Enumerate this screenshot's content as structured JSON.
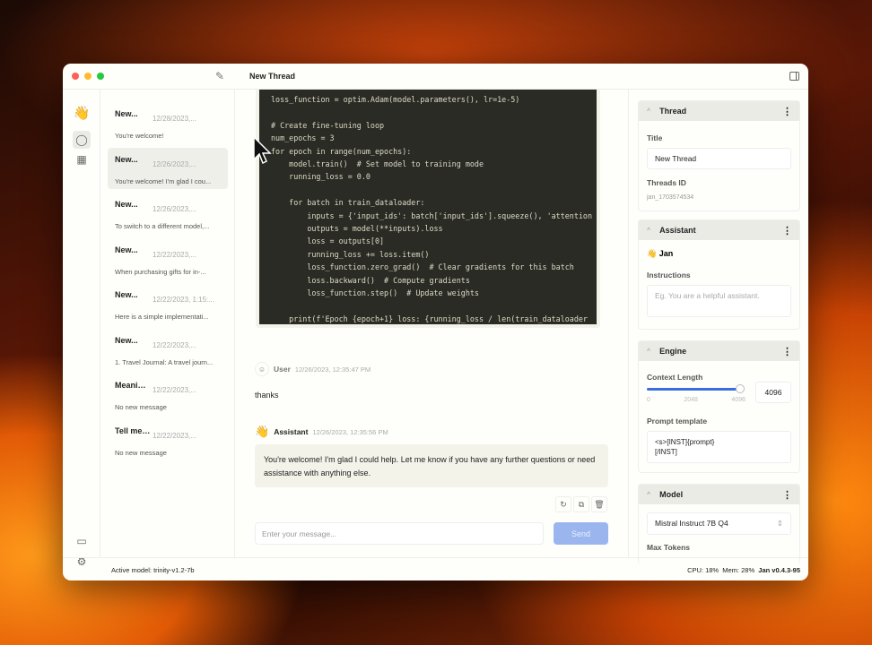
{
  "window": {
    "title": "New Thread"
  },
  "threads": [
    {
      "name": "New...",
      "date": "12/28/2023,...",
      "msg": "You're welcome!"
    },
    {
      "name": "New...",
      "date": "12/26/2023,...",
      "msg": "You're welcome! I'm glad I cou..."
    },
    {
      "name": "New...",
      "date": "12/26/2023,...",
      "msg": "To switch to a different model,..."
    },
    {
      "name": "New...",
      "date": "12/22/2023,...",
      "msg": "When purchasing gifts for in-..."
    },
    {
      "name": "New...",
      "date": "12/22/2023, 1:15:...",
      "msg": "Here is a simple implementati..."
    },
    {
      "name": "New...",
      "date": "12/22/2023,...",
      "msg": "1. Travel Journal: A travel journ..."
    },
    {
      "name": "Meaning ...",
      "date": "12/22/2023,...",
      "msg": "No new message"
    },
    {
      "name": "Tell me ...",
      "date": "12/22/2023,...",
      "msg": "No new message"
    }
  ],
  "code_lines": [
    "loss_function = optim.Adam(model.parameters(), lr=1e-5)",
    "",
    "# Create fine-tuning loop",
    "num_epochs = 3",
    "for epoch in range(num_epochs):",
    "    model.train()  # Set model to training mode",
    "    running_loss = 0.0",
    "",
    "    for batch in train_dataloader:",
    "        inputs = {'input_ids': batch['input_ids'].squeeze(), 'attention",
    "        outputs = model(**inputs).loss",
    "        loss = outputs[0]",
    "        running_loss += loss.item()",
    "        loss_function.zero_grad()  # Clear gradients for this batch",
    "        loss.backward()  # Compute gradients",
    "        loss_function.step()  # Update weights",
    "",
    "    print(f'Epoch {epoch+1} loss: {running_loss / len(train_dataloader"
  ],
  "messages": {
    "user": {
      "name": "User",
      "time": "12/26/2023, 12:35:47 PM",
      "text": "thanks"
    },
    "assistant": {
      "name": "Assistant",
      "time": "12/26/2023, 12:35:56 PM",
      "text": "You're welcome! I'm glad I could help. Let me know if you have any further questions or need assistance with anything else."
    }
  },
  "composer": {
    "placeholder": "Enter your message...",
    "send_label": "Send"
  },
  "panel": {
    "thread": {
      "header": "Thread",
      "title_label": "Title",
      "title_value": "New Thread",
      "id_label": "Threads ID",
      "id_value": "jan_1703574534"
    },
    "assistant": {
      "header": "Assistant",
      "name": "Jan",
      "instructions_label": "Instructions",
      "instructions_placeholder": "Eg. You are a helpful assistant."
    },
    "engine": {
      "header": "Engine",
      "context_label": "Context Length",
      "context_value": "4096",
      "context_fraction": 1.0,
      "ticks": [
        "0",
        "2048",
        "4096"
      ],
      "prompt_label": "Prompt template",
      "prompt_value": "<s>[INST]{prompt}\n[/INST]"
    },
    "model": {
      "header": "Model",
      "selected": "Mistral Instruct 7B Q4",
      "max_tokens_label": "Max Tokens"
    }
  },
  "status": {
    "active_model": "Active model: trinity-v1.2-7b",
    "cpu": "CPU: 18%",
    "mem": "Mem: 28%",
    "version": "Jan v0.4.3-95"
  },
  "colors": {
    "accent": "#3b6fe0",
    "send_disabled": "#9bb6ee",
    "code_bg": "#2b2b25"
  }
}
